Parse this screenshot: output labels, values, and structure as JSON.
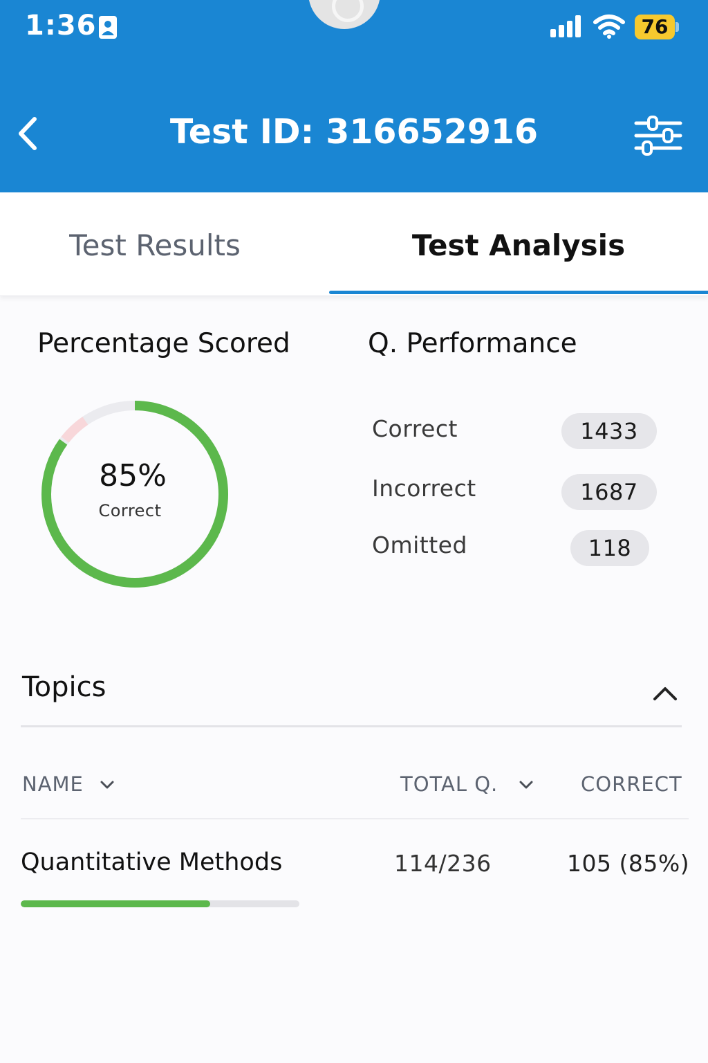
{
  "status_bar": {
    "time": "1:36",
    "battery": "76",
    "icons": [
      "person-badge-icon",
      "signal-icon",
      "wifi-icon",
      "battery-icon"
    ]
  },
  "header": {
    "title": "Test ID: 316652916",
    "icons": [
      "back-arrow-icon",
      "filter-sliders-icon"
    ]
  },
  "tabs": [
    {
      "label": "Test Results",
      "active": false
    },
    {
      "label": "Test Analysis",
      "active": true
    }
  ],
  "percentage": {
    "title": "Percentage Scored",
    "value_text": "85%",
    "label": "Correct",
    "fraction_correct": 0.85,
    "colors": {
      "correct": "#5cb84c",
      "incorrect": "#f8d7da",
      "omitted": "#ebebef"
    }
  },
  "performance": {
    "title": "Q. Performance",
    "items": [
      {
        "label": "Correct",
        "value": "1433"
      },
      {
        "label": "Incorrect",
        "value": "1687"
      },
      {
        "label": "Omitted",
        "value": "118"
      }
    ]
  },
  "topics": {
    "title": "Topics",
    "columns": {
      "name": "NAME",
      "total": "TOTAL Q.",
      "correct": "CORRECT"
    },
    "rows": [
      {
        "name": "Quantitative Methods",
        "total": "114/236",
        "correct": "105 (85%)",
        "progress": 0.68
      }
    ]
  },
  "colors": {
    "brand": "#1a86d3",
    "success": "#5cb84c"
  }
}
